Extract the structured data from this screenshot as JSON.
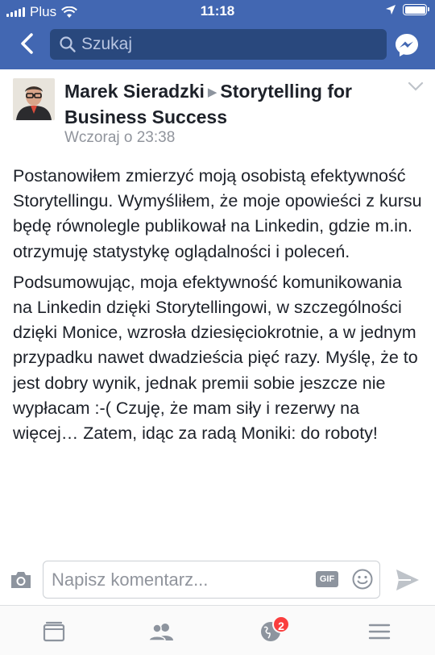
{
  "status_bar": {
    "carrier": "Plus",
    "time": "11:18"
  },
  "nav": {
    "search_placeholder": "Szukaj",
    "icons": [
      "back-arrow-icon",
      "search-icon",
      "messenger-icon"
    ]
  },
  "post": {
    "author": "Marek Sieradzki",
    "group": "Storytelling for Business Success",
    "timestamp": "Wczoraj o 23:38",
    "paragraphs": [
      "Postanowiłem zmierzyć moją osobistą efektywność Storytellingu. Wymyśliłem, że  moje opowieści z kursu będę równolegle publikował na Linkedin, gdzie m.in. otrzymuję statystykę oglądalności i poleceń.",
      "Podsumowując, moja efektywność komunikowania na Linkedin dzięki Storytellingowi, w szczególności dzięki Monice, wzrosła dziesięciokrotnie, a w jednym przypadku nawet dwadzieścia pięć razy. Myślę, że to jest dobry wynik, jednak premii  sobie jeszcze nie wypłacam :-(  Czuję, że mam siły i rezerwy na więcej… Zatem, idąc za radą Moniki: do roboty!"
    ]
  },
  "comment": {
    "placeholder": "Napisz komentarz...",
    "gif_label": "GIF"
  },
  "tabbar": {
    "notification_count": "2",
    "tabs": [
      "news-feed-icon",
      "friends-icon",
      "notifications-globe-icon",
      "menu-icon"
    ]
  },
  "colors": {
    "brand_blue": "#4267b2",
    "search_bg": "#29487d",
    "badge_red": "#fa3e3e",
    "secondary_text": "#90949c"
  }
}
